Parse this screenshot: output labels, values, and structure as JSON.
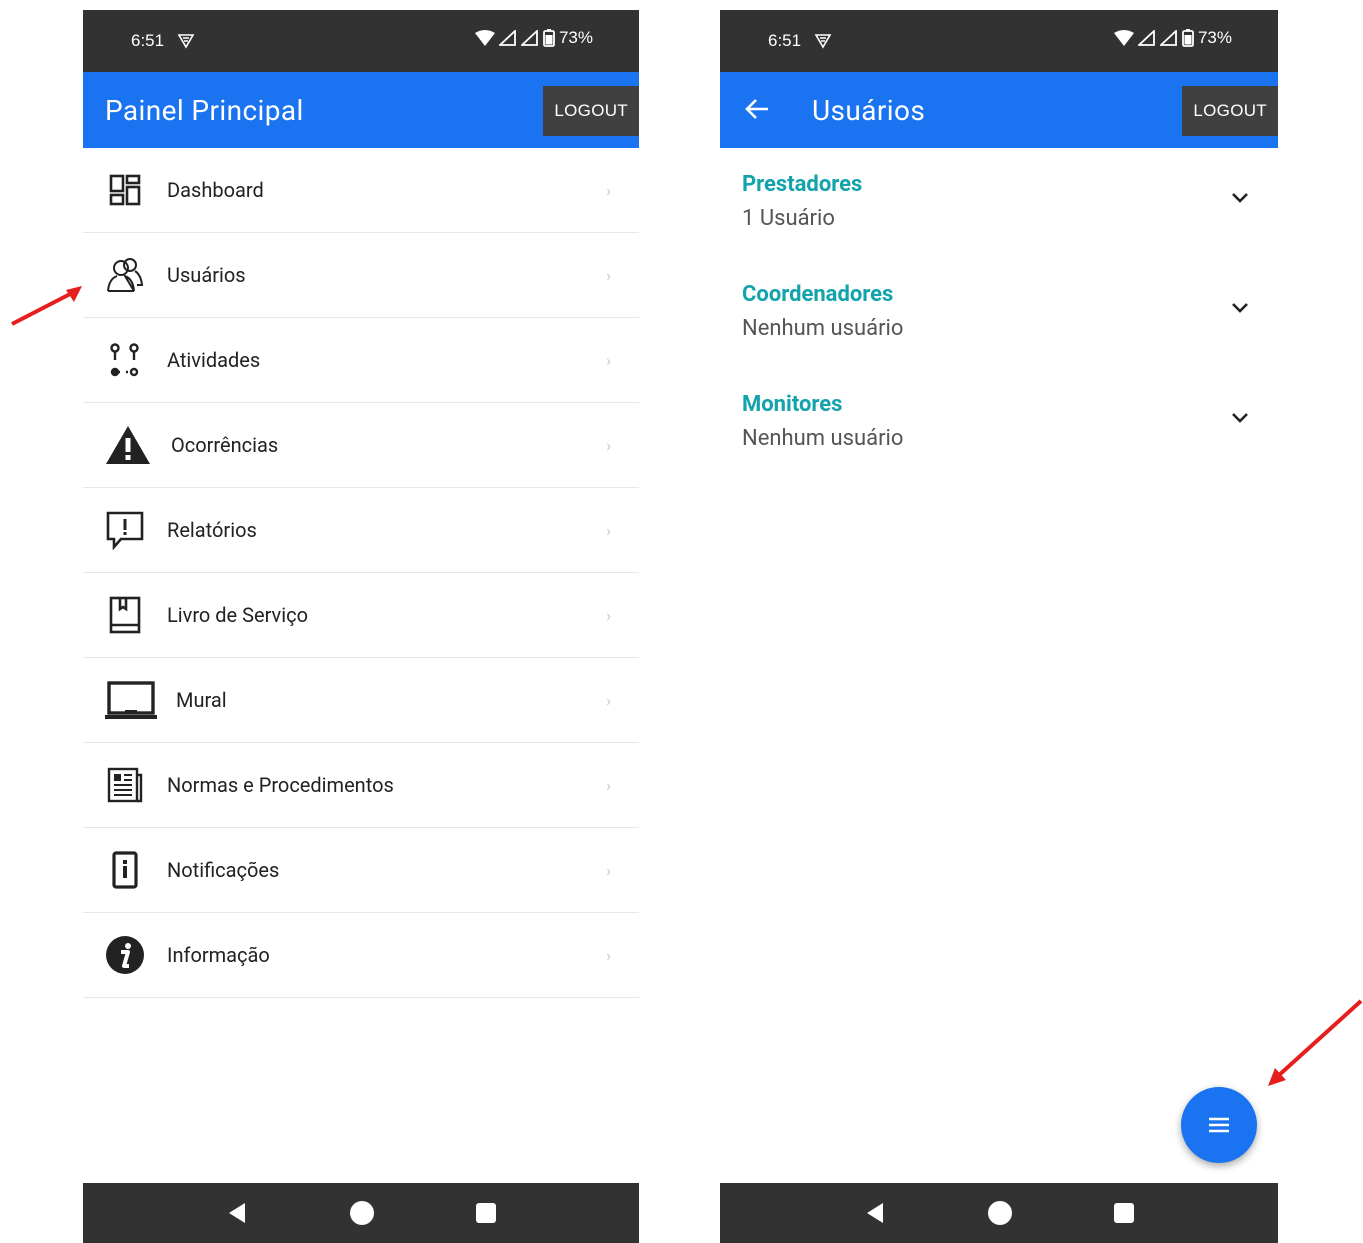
{
  "status_bar": {
    "time": "6:51",
    "battery": "73%"
  },
  "left_screen": {
    "title": "Painel Principal",
    "logout_label": "LOGOUT",
    "menu": [
      {
        "label": "Dashboard",
        "icon": "dashboard-icon"
      },
      {
        "label": "Usuários",
        "icon": "users-icon"
      },
      {
        "label": "Atividades",
        "icon": "route-icon"
      },
      {
        "label": "Ocorrências",
        "icon": "warning-icon"
      },
      {
        "label": "Relatórios",
        "icon": "report-icon"
      },
      {
        "label": "Livro de Serviço",
        "icon": "book-icon"
      },
      {
        "label": "Mural",
        "icon": "laptop-icon"
      },
      {
        "label": "Normas e Procedimentos",
        "icon": "document-icon"
      },
      {
        "label": "Notificações",
        "icon": "notification-icon"
      },
      {
        "label": "Informação",
        "icon": "info-icon"
      }
    ]
  },
  "right_screen": {
    "title": "Usuários",
    "logout_label": "LOGOUT",
    "groups": [
      {
        "title": "Prestadores",
        "subtitle": "1 Usuário"
      },
      {
        "title": "Coordenadores",
        "subtitle": "Nenhum usuário"
      },
      {
        "title": "Monitores",
        "subtitle": "Nenhum usuário"
      }
    ]
  },
  "colors": {
    "primary": "#1a73f0",
    "status_bar": "#323232",
    "accent_teal": "#12a3ac",
    "annotation_arrow": "#e61e1e"
  }
}
